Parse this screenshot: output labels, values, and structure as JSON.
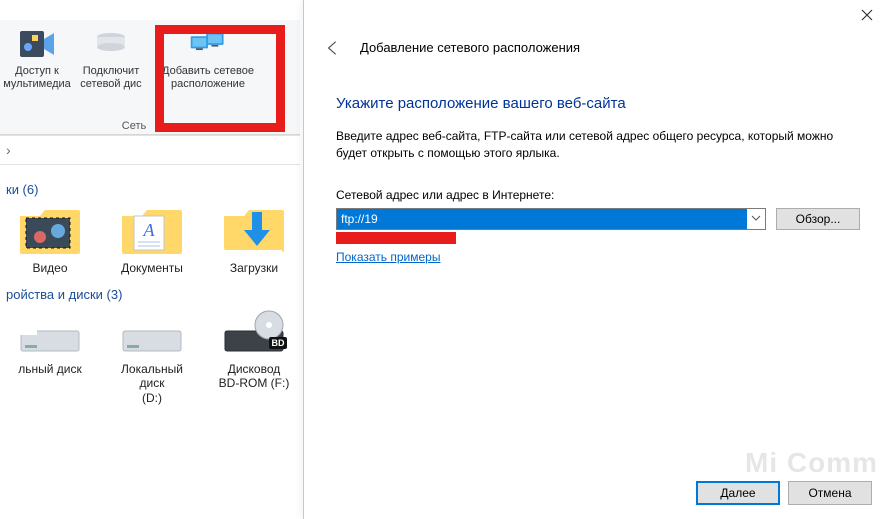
{
  "ribbon": {
    "buttons": [
      {
        "label": "Доступ к\nмультимедиа",
        "icon": "multimedia-icon"
      },
      {
        "label": "Подключит\nсетевой дис",
        "icon": "map-drive-icon"
      },
      {
        "label": "Добавить сетевое\nрасположение",
        "icon": "add-netloc-icon"
      }
    ],
    "group_label": "Сеть"
  },
  "addrbar_chevron": "›",
  "section_folders": {
    "title": "ки (6)",
    "items": [
      {
        "label": "Видео",
        "icon": "videos-folder-icon"
      },
      {
        "label": "Документы",
        "icon": "documents-folder-icon"
      },
      {
        "label": "Загрузки",
        "icon": "downloads-folder-icon"
      }
    ]
  },
  "section_drives": {
    "title": "ройства и диски (3)",
    "items": [
      {
        "label": "льный диск",
        "icon": "local-disk-icon"
      },
      {
        "label": "Локальный диск\n(D:)",
        "icon": "local-disk-icon"
      },
      {
        "label": "Дисковод\nBD-ROM (F:)",
        "icon": "bd-rom-icon"
      }
    ]
  },
  "dialog": {
    "title": "Добавление сетевого расположения",
    "heading": "Укажите расположение вашего веб-сайта",
    "description": "Введите адрес веб-сайта, FTP-сайта или сетевой адрес общего ресурса, который можно будет открыть с помощью этого ярлыка.",
    "field_label": "Сетевой адрес или адрес в Интернете:",
    "address_value": "ftp://19",
    "browse_label": "Обзор...",
    "examples_link": "Показать примеры",
    "next_label": "Далее",
    "cancel_label": "Отмена"
  },
  "watermark": "Mi Comm"
}
